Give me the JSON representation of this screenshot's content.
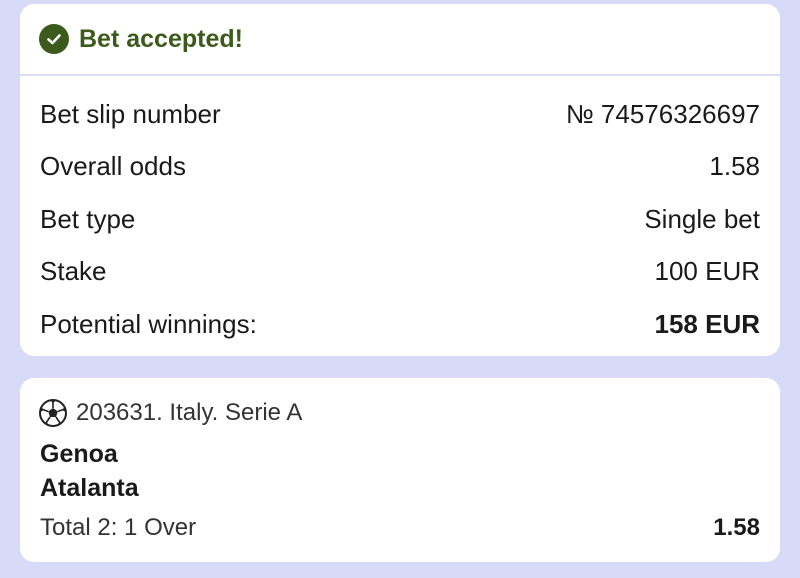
{
  "confirmation": {
    "title": "Bet accepted!",
    "icon": "check-circle-icon",
    "accent_color": "#3b5a1c"
  },
  "summary": {
    "rows": [
      {
        "label": "Bet slip number",
        "value": "№ 74576326697"
      },
      {
        "label": "Overall odds",
        "value": "1.58"
      },
      {
        "label": "Bet type",
        "value": "Single bet"
      },
      {
        "label": "Stake",
        "value": "100 EUR"
      },
      {
        "label": "Potential winnings:",
        "value": "158 EUR"
      }
    ]
  },
  "event": {
    "sport_icon": "soccer-ball-icon",
    "league": "203631. Italy. Serie A",
    "home_team": "Genoa",
    "away_team": "Atalanta",
    "market": "Total 2: 1 Over",
    "odds": "1.58"
  }
}
